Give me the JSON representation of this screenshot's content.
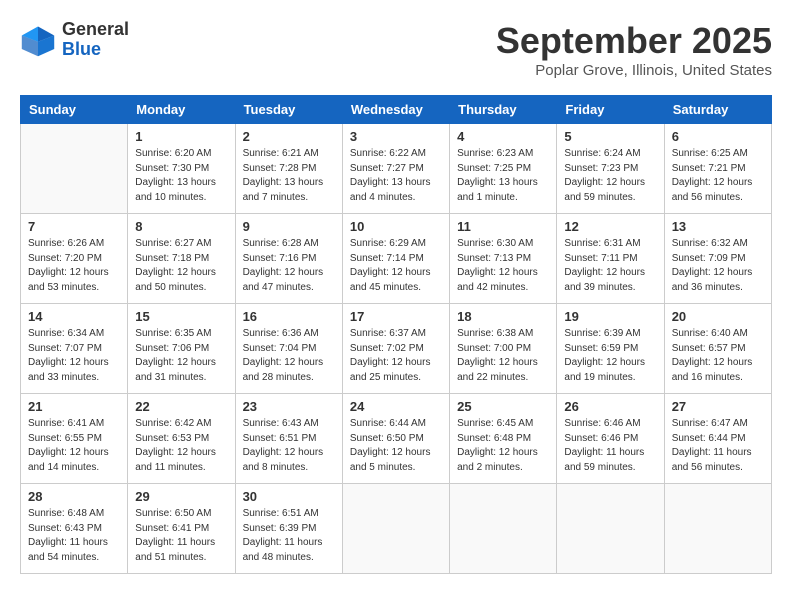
{
  "logo": {
    "line1": "General",
    "line2": "Blue"
  },
  "title": "September 2025",
  "subtitle": "Poplar Grove, Illinois, United States",
  "days_of_week": [
    "Sunday",
    "Monday",
    "Tuesday",
    "Wednesday",
    "Thursday",
    "Friday",
    "Saturday"
  ],
  "weeks": [
    [
      {
        "day": "",
        "content": ""
      },
      {
        "day": "1",
        "content": "Sunrise: 6:20 AM\nSunset: 7:30 PM\nDaylight: 13 hours\nand 10 minutes."
      },
      {
        "day": "2",
        "content": "Sunrise: 6:21 AM\nSunset: 7:28 PM\nDaylight: 13 hours\nand 7 minutes."
      },
      {
        "day": "3",
        "content": "Sunrise: 6:22 AM\nSunset: 7:27 PM\nDaylight: 13 hours\nand 4 minutes."
      },
      {
        "day": "4",
        "content": "Sunrise: 6:23 AM\nSunset: 7:25 PM\nDaylight: 13 hours\nand 1 minute."
      },
      {
        "day": "5",
        "content": "Sunrise: 6:24 AM\nSunset: 7:23 PM\nDaylight: 12 hours\nand 59 minutes."
      },
      {
        "day": "6",
        "content": "Sunrise: 6:25 AM\nSunset: 7:21 PM\nDaylight: 12 hours\nand 56 minutes."
      }
    ],
    [
      {
        "day": "7",
        "content": "Sunrise: 6:26 AM\nSunset: 7:20 PM\nDaylight: 12 hours\nand 53 minutes."
      },
      {
        "day": "8",
        "content": "Sunrise: 6:27 AM\nSunset: 7:18 PM\nDaylight: 12 hours\nand 50 minutes."
      },
      {
        "day": "9",
        "content": "Sunrise: 6:28 AM\nSunset: 7:16 PM\nDaylight: 12 hours\nand 47 minutes."
      },
      {
        "day": "10",
        "content": "Sunrise: 6:29 AM\nSunset: 7:14 PM\nDaylight: 12 hours\nand 45 minutes."
      },
      {
        "day": "11",
        "content": "Sunrise: 6:30 AM\nSunset: 7:13 PM\nDaylight: 12 hours\nand 42 minutes."
      },
      {
        "day": "12",
        "content": "Sunrise: 6:31 AM\nSunset: 7:11 PM\nDaylight: 12 hours\nand 39 minutes."
      },
      {
        "day": "13",
        "content": "Sunrise: 6:32 AM\nSunset: 7:09 PM\nDaylight: 12 hours\nand 36 minutes."
      }
    ],
    [
      {
        "day": "14",
        "content": "Sunrise: 6:34 AM\nSunset: 7:07 PM\nDaylight: 12 hours\nand 33 minutes."
      },
      {
        "day": "15",
        "content": "Sunrise: 6:35 AM\nSunset: 7:06 PM\nDaylight: 12 hours\nand 31 minutes."
      },
      {
        "day": "16",
        "content": "Sunrise: 6:36 AM\nSunset: 7:04 PM\nDaylight: 12 hours\nand 28 minutes."
      },
      {
        "day": "17",
        "content": "Sunrise: 6:37 AM\nSunset: 7:02 PM\nDaylight: 12 hours\nand 25 minutes."
      },
      {
        "day": "18",
        "content": "Sunrise: 6:38 AM\nSunset: 7:00 PM\nDaylight: 12 hours\nand 22 minutes."
      },
      {
        "day": "19",
        "content": "Sunrise: 6:39 AM\nSunset: 6:59 PM\nDaylight: 12 hours\nand 19 minutes."
      },
      {
        "day": "20",
        "content": "Sunrise: 6:40 AM\nSunset: 6:57 PM\nDaylight: 12 hours\nand 16 minutes."
      }
    ],
    [
      {
        "day": "21",
        "content": "Sunrise: 6:41 AM\nSunset: 6:55 PM\nDaylight: 12 hours\nand 14 minutes."
      },
      {
        "day": "22",
        "content": "Sunrise: 6:42 AM\nSunset: 6:53 PM\nDaylight: 12 hours\nand 11 minutes."
      },
      {
        "day": "23",
        "content": "Sunrise: 6:43 AM\nSunset: 6:51 PM\nDaylight: 12 hours\nand 8 minutes."
      },
      {
        "day": "24",
        "content": "Sunrise: 6:44 AM\nSunset: 6:50 PM\nDaylight: 12 hours\nand 5 minutes."
      },
      {
        "day": "25",
        "content": "Sunrise: 6:45 AM\nSunset: 6:48 PM\nDaylight: 12 hours\nand 2 minutes."
      },
      {
        "day": "26",
        "content": "Sunrise: 6:46 AM\nSunset: 6:46 PM\nDaylight: 11 hours\nand 59 minutes."
      },
      {
        "day": "27",
        "content": "Sunrise: 6:47 AM\nSunset: 6:44 PM\nDaylight: 11 hours\nand 56 minutes."
      }
    ],
    [
      {
        "day": "28",
        "content": "Sunrise: 6:48 AM\nSunset: 6:43 PM\nDaylight: 11 hours\nand 54 minutes."
      },
      {
        "day": "29",
        "content": "Sunrise: 6:50 AM\nSunset: 6:41 PM\nDaylight: 11 hours\nand 51 minutes."
      },
      {
        "day": "30",
        "content": "Sunrise: 6:51 AM\nSunset: 6:39 PM\nDaylight: 11 hours\nand 48 minutes."
      },
      {
        "day": "",
        "content": ""
      },
      {
        "day": "",
        "content": ""
      },
      {
        "day": "",
        "content": ""
      },
      {
        "day": "",
        "content": ""
      }
    ]
  ]
}
